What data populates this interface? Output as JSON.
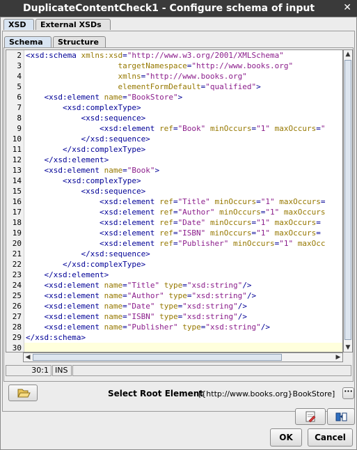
{
  "window": {
    "title": "DuplicateContentCheck1 - Configure schema of input"
  },
  "top_tabs": [
    {
      "label": "XSD",
      "selected": true
    },
    {
      "label": "External XSDs",
      "selected": false
    }
  ],
  "sub_tabs": [
    {
      "label": "Schema",
      "selected": true
    },
    {
      "label": "Structure",
      "selected": false
    }
  ],
  "editor": {
    "line_numbers": [
      "2",
      "3",
      "4",
      "5",
      "6",
      "7",
      "8",
      "9",
      "10",
      "11",
      "12",
      "13",
      "14",
      "15",
      "16",
      "17",
      "18",
      "19",
      "20",
      "21",
      "22",
      "23",
      "24",
      "25",
      "26",
      "27",
      "28",
      "29",
      "30"
    ],
    "lines": [
      [
        {
          "t": "tag",
          "v": "<xsd:schema "
        },
        {
          "t": "attr",
          "v": "xmlns:xsd"
        },
        {
          "t": "tag",
          "v": "="
        },
        {
          "t": "val",
          "v": "\"http://www.w3.org/2001/XMLSchema\""
        }
      ],
      [
        {
          "t": "tag",
          "v": "                    "
        },
        {
          "t": "attr",
          "v": "targetNamespace"
        },
        {
          "t": "tag",
          "v": "="
        },
        {
          "t": "val",
          "v": "\"http://www.books.org\""
        }
      ],
      [
        {
          "t": "tag",
          "v": "                    "
        },
        {
          "t": "attr",
          "v": "xmlns"
        },
        {
          "t": "tag",
          "v": "="
        },
        {
          "t": "val",
          "v": "\"http://www.books.org\""
        }
      ],
      [
        {
          "t": "tag",
          "v": "                    "
        },
        {
          "t": "attr",
          "v": "elementFormDefault"
        },
        {
          "t": "tag",
          "v": "="
        },
        {
          "t": "val",
          "v": "\"qualified\""
        },
        {
          "t": "tag",
          "v": ">"
        }
      ],
      [
        {
          "t": "tag",
          "v": "    <xsd:element "
        },
        {
          "t": "attr",
          "v": "name"
        },
        {
          "t": "tag",
          "v": "="
        },
        {
          "t": "val",
          "v": "\"BookStore\""
        },
        {
          "t": "tag",
          "v": ">"
        }
      ],
      [
        {
          "t": "tag",
          "v": "        <xsd:complexType>"
        }
      ],
      [
        {
          "t": "tag",
          "v": "            <xsd:sequence>"
        }
      ],
      [
        {
          "t": "tag",
          "v": "                <xsd:element "
        },
        {
          "t": "attr",
          "v": "ref"
        },
        {
          "t": "tag",
          "v": "="
        },
        {
          "t": "val",
          "v": "\"Book\""
        },
        {
          "t": "tag",
          "v": " "
        },
        {
          "t": "attr",
          "v": "minOccurs"
        },
        {
          "t": "tag",
          "v": "="
        },
        {
          "t": "val",
          "v": "\"1\""
        },
        {
          "t": "tag",
          "v": " "
        },
        {
          "t": "attr",
          "v": "maxOccurs"
        },
        {
          "t": "tag",
          "v": "="
        },
        {
          "t": "val",
          "v": "\""
        }
      ],
      [
        {
          "t": "tag",
          "v": "            </xsd:sequence>"
        }
      ],
      [
        {
          "t": "tag",
          "v": "        </xsd:complexType>"
        }
      ],
      [
        {
          "t": "tag",
          "v": "    </xsd:element>"
        }
      ],
      [
        {
          "t": "tag",
          "v": "    <xsd:element "
        },
        {
          "t": "attr",
          "v": "name"
        },
        {
          "t": "tag",
          "v": "="
        },
        {
          "t": "val",
          "v": "\"Book\""
        },
        {
          "t": "tag",
          "v": ">"
        }
      ],
      [
        {
          "t": "tag",
          "v": "        <xsd:complexType>"
        }
      ],
      [
        {
          "t": "tag",
          "v": "            <xsd:sequence>"
        }
      ],
      [
        {
          "t": "tag",
          "v": "                <xsd:element "
        },
        {
          "t": "attr",
          "v": "ref"
        },
        {
          "t": "tag",
          "v": "="
        },
        {
          "t": "val",
          "v": "\"Title\""
        },
        {
          "t": "tag",
          "v": " "
        },
        {
          "t": "attr",
          "v": "minOccurs"
        },
        {
          "t": "tag",
          "v": "="
        },
        {
          "t": "val",
          "v": "\"1\""
        },
        {
          "t": "tag",
          "v": " "
        },
        {
          "t": "attr",
          "v": "maxOccurs"
        },
        {
          "t": "tag",
          "v": "="
        }
      ],
      [
        {
          "t": "tag",
          "v": "                <xsd:element "
        },
        {
          "t": "attr",
          "v": "ref"
        },
        {
          "t": "tag",
          "v": "="
        },
        {
          "t": "val",
          "v": "\"Author\""
        },
        {
          "t": "tag",
          "v": " "
        },
        {
          "t": "attr",
          "v": "minOccurs"
        },
        {
          "t": "tag",
          "v": "="
        },
        {
          "t": "val",
          "v": "\"1\""
        },
        {
          "t": "tag",
          "v": " "
        },
        {
          "t": "attr",
          "v": "maxOccurs"
        }
      ],
      [
        {
          "t": "tag",
          "v": "                <xsd:element "
        },
        {
          "t": "attr",
          "v": "ref"
        },
        {
          "t": "tag",
          "v": "="
        },
        {
          "t": "val",
          "v": "\"Date\""
        },
        {
          "t": "tag",
          "v": " "
        },
        {
          "t": "attr",
          "v": "minOccurs"
        },
        {
          "t": "tag",
          "v": "="
        },
        {
          "t": "val",
          "v": "\"1\""
        },
        {
          "t": "tag",
          "v": " "
        },
        {
          "t": "attr",
          "v": "maxOccurs"
        },
        {
          "t": "tag",
          "v": "="
        }
      ],
      [
        {
          "t": "tag",
          "v": "                <xsd:element "
        },
        {
          "t": "attr",
          "v": "ref"
        },
        {
          "t": "tag",
          "v": "="
        },
        {
          "t": "val",
          "v": "\"ISBN\""
        },
        {
          "t": "tag",
          "v": " "
        },
        {
          "t": "attr",
          "v": "minOccurs"
        },
        {
          "t": "tag",
          "v": "="
        },
        {
          "t": "val",
          "v": "\"1\""
        },
        {
          "t": "tag",
          "v": " "
        },
        {
          "t": "attr",
          "v": "maxOccurs"
        },
        {
          "t": "tag",
          "v": "="
        }
      ],
      [
        {
          "t": "tag",
          "v": "                <xsd:element "
        },
        {
          "t": "attr",
          "v": "ref"
        },
        {
          "t": "tag",
          "v": "="
        },
        {
          "t": "val",
          "v": "\"Publisher\""
        },
        {
          "t": "tag",
          "v": " "
        },
        {
          "t": "attr",
          "v": "minOccurs"
        },
        {
          "t": "tag",
          "v": "="
        },
        {
          "t": "val",
          "v": "\"1\""
        },
        {
          "t": "tag",
          "v": " "
        },
        {
          "t": "attr",
          "v": "maxOcc"
        }
      ],
      [
        {
          "t": "tag",
          "v": "            </xsd:sequence>"
        }
      ],
      [
        {
          "t": "tag",
          "v": "        </xsd:complexType>"
        }
      ],
      [
        {
          "t": "tag",
          "v": "    </xsd:element>"
        }
      ],
      [
        {
          "t": "tag",
          "v": "    <xsd:element "
        },
        {
          "t": "attr",
          "v": "name"
        },
        {
          "t": "tag",
          "v": "="
        },
        {
          "t": "val",
          "v": "\"Title\""
        },
        {
          "t": "tag",
          "v": " "
        },
        {
          "t": "attr",
          "v": "type"
        },
        {
          "t": "tag",
          "v": "="
        },
        {
          "t": "val",
          "v": "\"xsd:string\""
        },
        {
          "t": "tag",
          "v": "/>"
        }
      ],
      [
        {
          "t": "tag",
          "v": "    <xsd:element "
        },
        {
          "t": "attr",
          "v": "name"
        },
        {
          "t": "tag",
          "v": "="
        },
        {
          "t": "val",
          "v": "\"Author\""
        },
        {
          "t": "tag",
          "v": " "
        },
        {
          "t": "attr",
          "v": "type"
        },
        {
          "t": "tag",
          "v": "="
        },
        {
          "t": "val",
          "v": "\"xsd:string\""
        },
        {
          "t": "tag",
          "v": "/>"
        }
      ],
      [
        {
          "t": "tag",
          "v": "    <xsd:element "
        },
        {
          "t": "attr",
          "v": "name"
        },
        {
          "t": "tag",
          "v": "="
        },
        {
          "t": "val",
          "v": "\"Date\""
        },
        {
          "t": "tag",
          "v": " "
        },
        {
          "t": "attr",
          "v": "type"
        },
        {
          "t": "tag",
          "v": "="
        },
        {
          "t": "val",
          "v": "\"xsd:string\""
        },
        {
          "t": "tag",
          "v": "/>"
        }
      ],
      [
        {
          "t": "tag",
          "v": "    <xsd:element "
        },
        {
          "t": "attr",
          "v": "name"
        },
        {
          "t": "tag",
          "v": "="
        },
        {
          "t": "val",
          "v": "\"ISBN\""
        },
        {
          "t": "tag",
          "v": " "
        },
        {
          "t": "attr",
          "v": "type"
        },
        {
          "t": "tag",
          "v": "="
        },
        {
          "t": "val",
          "v": "\"xsd:string\""
        },
        {
          "t": "tag",
          "v": "/>"
        }
      ],
      [
        {
          "t": "tag",
          "v": "    <xsd:element "
        },
        {
          "t": "attr",
          "v": "name"
        },
        {
          "t": "tag",
          "v": "="
        },
        {
          "t": "val",
          "v": "\"Publisher\""
        },
        {
          "t": "tag",
          "v": " "
        },
        {
          "t": "attr",
          "v": "type"
        },
        {
          "t": "tag",
          "v": "="
        },
        {
          "t": "val",
          "v": "\"xsd:string\""
        },
        {
          "t": "tag",
          "v": "/>"
        }
      ],
      [
        {
          "t": "tag",
          "v": "</xsd:schema>"
        }
      ],
      []
    ],
    "current_line_index": 28,
    "colors": {
      "tag": "#000096",
      "attr": "#967800",
      "value": "#8b1d8b",
      "current_line": "#ffffdc"
    }
  },
  "status_bar": {
    "position": "30:1",
    "mode": "INS"
  },
  "root_element": {
    "label": "Select Root Element",
    "value": "[{http://www.books.org}BookStore]"
  },
  "buttons": {
    "ok": "OK",
    "cancel": "Cancel"
  },
  "icons": {
    "open": "folder-open-icon",
    "browse": "ellipsis-icon",
    "edit": "edit-icon",
    "test": "test-icon",
    "close": "close-icon"
  }
}
